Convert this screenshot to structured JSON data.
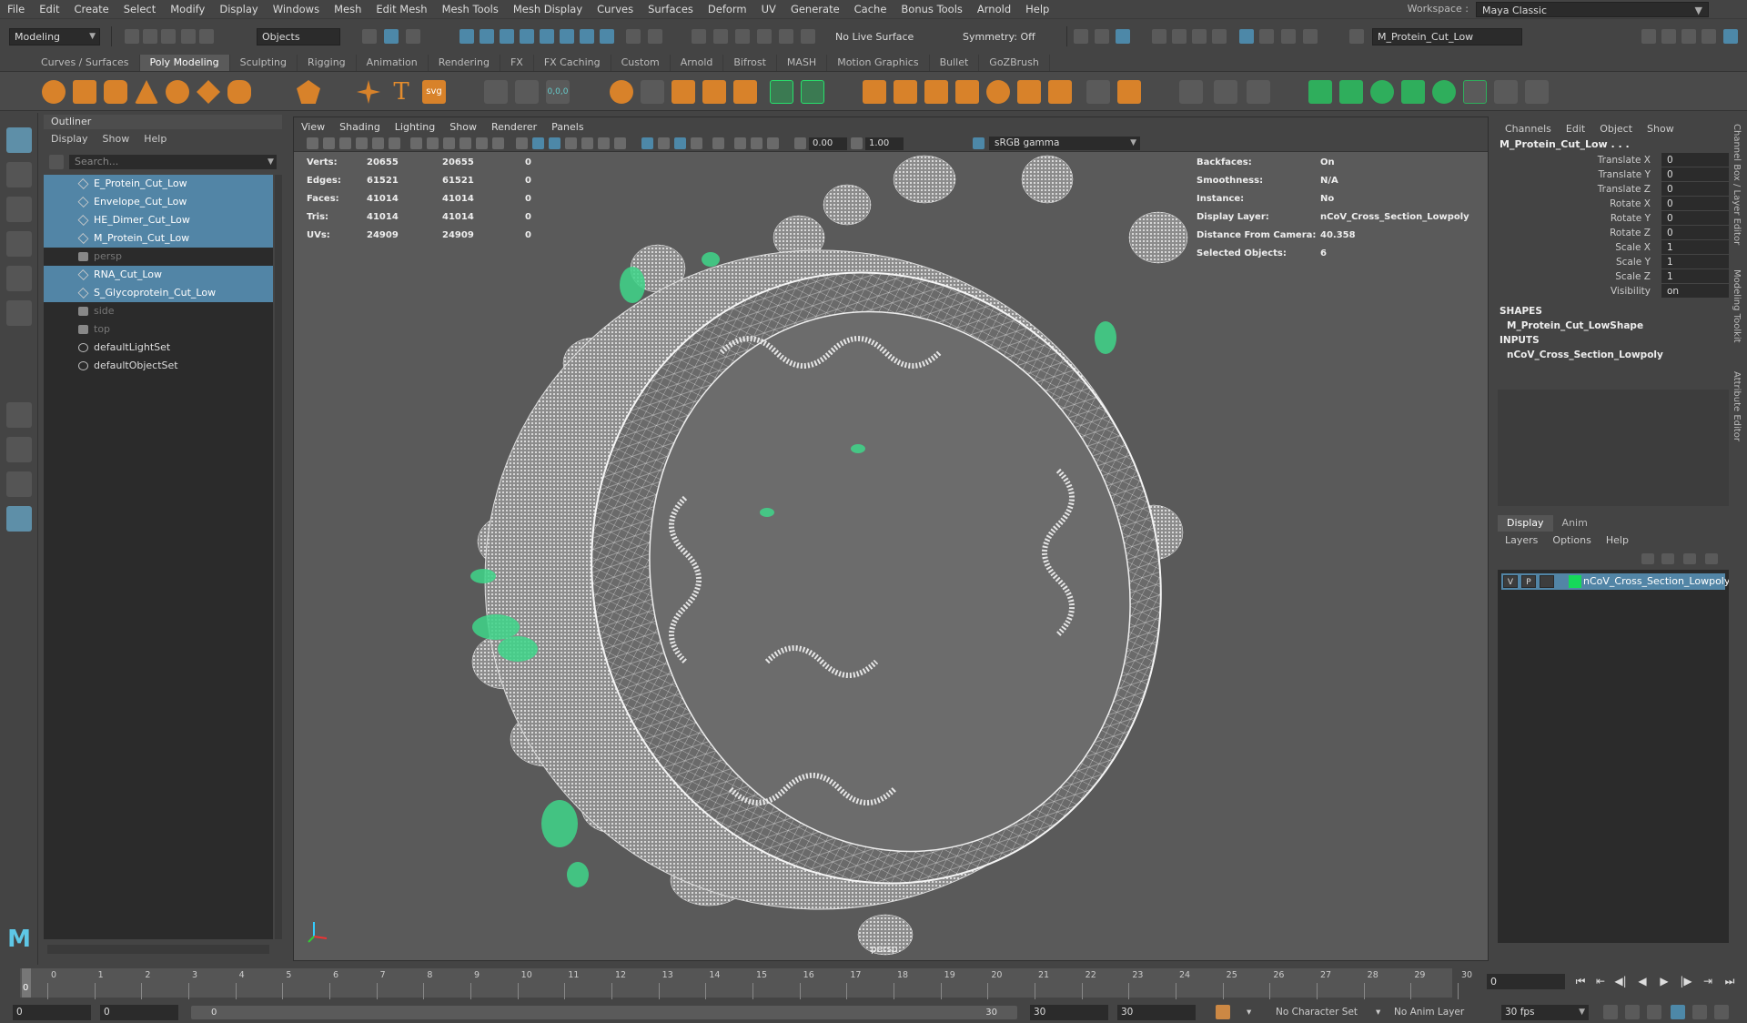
{
  "menubar": {
    "items": [
      "File",
      "Edit",
      "Create",
      "Select",
      "Modify",
      "Display",
      "Windows",
      "Mesh",
      "Edit Mesh",
      "Mesh Tools",
      "Mesh Display",
      "Curves",
      "Surfaces",
      "Deform",
      "UV",
      "Generate",
      "Cache",
      "Bonus Tools",
      "Arnold",
      "Help"
    ],
    "workspace_label": "Workspace :",
    "workspace_value": "Maya Classic"
  },
  "statusline": {
    "menuset": "Modeling",
    "selection_mode": "Objects",
    "live_surface": "No Live Surface",
    "symmetry": "Symmetry: Off",
    "object_name_field": "M_Protein_Cut_Low"
  },
  "shelf": {
    "tabs": [
      "Curves / Surfaces",
      "Poly Modeling",
      "Sculpting",
      "Rigging",
      "Animation",
      "Rendering",
      "FX",
      "FX Caching",
      "Custom",
      "Arnold",
      "Bifrost",
      "MASH",
      "Motion Graphics",
      "Bullet",
      "GoZBrush"
    ],
    "active_tab": "Poly Modeling",
    "svg_label": "svg",
    "text_label": "T",
    "coords_label": "0,0,0"
  },
  "outliner": {
    "title": "Outliner",
    "menu": [
      "Display",
      "Show",
      "Help"
    ],
    "search_placeholder": "Search...",
    "items": [
      {
        "label": "E_Protein_Cut_Low",
        "type": "mesh",
        "selected": true
      },
      {
        "label": "Envelope_Cut_Low",
        "type": "mesh",
        "selected": true
      },
      {
        "label": "HE_Dimer_Cut_Low",
        "type": "mesh",
        "selected": true
      },
      {
        "label": "M_Protein_Cut_Low",
        "type": "mesh",
        "selected": true
      },
      {
        "label": "persp",
        "type": "camera",
        "selected": false
      },
      {
        "label": "RNA_Cut_Low",
        "type": "mesh",
        "selected": true
      },
      {
        "label": "S_Glycoprotein_Cut_Low",
        "type": "mesh",
        "selected": true
      },
      {
        "label": "side",
        "type": "camera",
        "selected": false
      },
      {
        "label": "top",
        "type": "camera",
        "selected": false
      },
      {
        "label": "defaultLightSet",
        "type": "set",
        "selected": false
      },
      {
        "label": "defaultObjectSet",
        "type": "set",
        "selected": false
      }
    ]
  },
  "viewport": {
    "menu": [
      "View",
      "Shading",
      "Lighting",
      "Show",
      "Renderer",
      "Panels"
    ],
    "exposure": "0.00",
    "gamma": "1.00",
    "colorspace": "sRGB gamma",
    "camera_label": "persp",
    "hud_stats": [
      {
        "label": "Verts:",
        "a": "20655",
        "b": "20655",
        "c": "0"
      },
      {
        "label": "Edges:",
        "a": "61521",
        "b": "61521",
        "c": "0"
      },
      {
        "label": "Faces:",
        "a": "41014",
        "b": "41014",
        "c": "0"
      },
      {
        "label": "Tris:",
        "a": "41014",
        "b": "41014",
        "c": "0"
      },
      {
        "label": "UVs:",
        "a": "24909",
        "b": "24909",
        "c": "0"
      }
    ],
    "hud_info": [
      {
        "label": "Backfaces:",
        "value": "On"
      },
      {
        "label": "Smoothness:",
        "value": "N/A"
      },
      {
        "label": "Instance:",
        "value": "No"
      },
      {
        "label": "Display Layer:",
        "value": "nCoV_Cross_Section_Lowpoly"
      },
      {
        "label": "Distance From Camera:",
        "value": "40.358"
      },
      {
        "label": "Selected Objects:",
        "value": "6"
      }
    ]
  },
  "channelbox": {
    "menu": [
      "Channels",
      "Edit",
      "Object",
      "Show"
    ],
    "object": "M_Protein_Cut_Low . . .",
    "attributes": [
      {
        "label": "Translate X",
        "value": "0"
      },
      {
        "label": "Translate Y",
        "value": "0"
      },
      {
        "label": "Translate Z",
        "value": "0"
      },
      {
        "label": "Rotate X",
        "value": "0"
      },
      {
        "label": "Rotate Y",
        "value": "0"
      },
      {
        "label": "Rotate Z",
        "value": "0"
      },
      {
        "label": "Scale X",
        "value": "1"
      },
      {
        "label": "Scale Y",
        "value": "1"
      },
      {
        "label": "Scale Z",
        "value": "1"
      },
      {
        "label": "Visibility",
        "value": "on"
      }
    ],
    "shapes_header": "SHAPES",
    "shape_name": "M_Protein_Cut_LowShape",
    "inputs_header": "INPUTS",
    "input_name": "nCoV_Cross_Section_Lowpoly"
  },
  "layer_editor": {
    "tabs": [
      "Display",
      "Anim"
    ],
    "active_tab": "Display",
    "menu": [
      "Layers",
      "Options",
      "Help"
    ],
    "layer": {
      "visible": "V",
      "playback": "P",
      "name": "nCoV_Cross_Section_Lowpoly",
      "color": "#16d85a"
    }
  },
  "side_tabs": [
    "Channel Box / Layer Editor",
    "Modeling Toolkit",
    "Attribute Editor"
  ],
  "timeline": {
    "ticks": [
      "0",
      "1",
      "2",
      "3",
      "4",
      "5",
      "6",
      "7",
      "8",
      "9",
      "10",
      "11",
      "12",
      "13",
      "14",
      "15",
      "16",
      "17",
      "18",
      "19",
      "20",
      "21",
      "22",
      "23",
      "24",
      "25",
      "26",
      "27",
      "28",
      "29",
      "30"
    ],
    "current_frame": "0",
    "current_frame_marker": "0"
  },
  "range": {
    "start": "0",
    "anim_start": "0",
    "slider_start": "0",
    "slider_end": "30",
    "anim_end": "30",
    "end": "30",
    "character_set": "No Character Set",
    "anim_layer": "No Anim Layer",
    "fps": "30 fps"
  },
  "colors": {
    "selection": "#5285a6",
    "accent_green": "#3fd68a",
    "panel_bg": "#444444",
    "field_bg": "#2b2b2b"
  }
}
